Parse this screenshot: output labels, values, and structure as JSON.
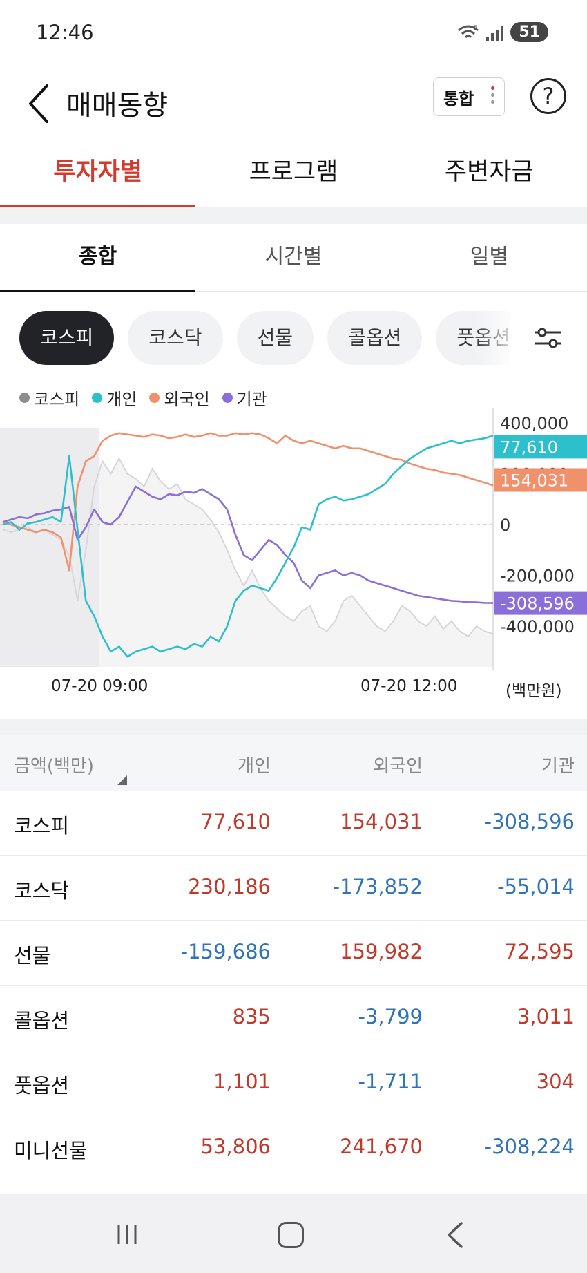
{
  "status": {
    "time": "12:46",
    "wifi_badge": "5",
    "battery": "51"
  },
  "header": {
    "title": "매매동향",
    "combined_label": "통합",
    "help_label": "?"
  },
  "main_tabs": [
    {
      "label": "투자자별",
      "active": true
    },
    {
      "label": "프로그램",
      "active": false
    },
    {
      "label": "주변자금",
      "active": false
    }
  ],
  "sub_tabs": [
    {
      "label": "종합",
      "active": true
    },
    {
      "label": "시간별",
      "active": false
    },
    {
      "label": "일별",
      "active": false
    }
  ],
  "chips": [
    {
      "label": "코스피",
      "active": true
    },
    {
      "label": "코스닥",
      "active": false
    },
    {
      "label": "선물",
      "active": false
    },
    {
      "label": "콜옵션",
      "active": false
    },
    {
      "label": "풋옵션",
      "active": false
    }
  ],
  "chart_data": {
    "type": "line",
    "legend": [
      {
        "label": "코스피",
        "color": "#8e8e92"
      },
      {
        "label": "개인",
        "color": "#2ebfcc"
      },
      {
        "label": "외국인",
        "color": "#f0916c"
      },
      {
        "label": "기관",
        "color": "#8a6fd8"
      }
    ],
    "y_ticks": [
      "400,000",
      "200,000",
      "0",
      "-200,000",
      "-400,000"
    ],
    "y_values": [
      400000,
      200000,
      0,
      -200000,
      -400000
    ],
    "ylim": [
      -560000,
      460000
    ],
    "x_labels": [
      "07-20 09:00",
      "07-20 12:00"
    ],
    "unit": "(백만원)",
    "end_labels": {
      "foreign": {
        "text": "154,031",
        "color": "#f0916c"
      },
      "individual": {
        "text": "77,610",
        "color": "#2ebfcc"
      },
      "institution": {
        "text": "-308,596",
        "color": "#8a6fd8"
      }
    },
    "x_steps": 60,
    "series": {
      "individual": [
        0,
        10000,
        -20000,
        5000,
        10000,
        20000,
        30000,
        10000,
        270000,
        -20000,
        -300000,
        -360000,
        -440000,
        -500000,
        -480000,
        -520000,
        -500000,
        -490000,
        -480000,
        -500000,
        -490000,
        -480000,
        -490000,
        -470000,
        -480000,
        -440000,
        -460000,
        -400000,
        -300000,
        -260000,
        -240000,
        -250000,
        -260000,
        -210000,
        -150000,
        -90000,
        -10000,
        -20000,
        80000,
        100000,
        110000,
        95000,
        100000,
        110000,
        120000,
        140000,
        160000,
        200000,
        230000,
        260000,
        280000,
        300000,
        310000,
        320000,
        330000,
        320000,
        330000,
        335000,
        340000,
        350000
      ],
      "foreign": [
        10000,
        0,
        -10000,
        -20000,
        -30000,
        -20000,
        -30000,
        -50000,
        -180000,
        150000,
        250000,
        270000,
        330000,
        350000,
        360000,
        355000,
        350000,
        345000,
        355000,
        350000,
        340000,
        345000,
        355000,
        345000,
        350000,
        360000,
        350000,
        350000,
        360000,
        355000,
        360000,
        355000,
        340000,
        320000,
        350000,
        330000,
        320000,
        330000,
        320000,
        310000,
        300000,
        310000,
        300000,
        300000,
        290000,
        280000,
        270000,
        260000,
        255000,
        240000,
        230000,
        220000,
        215000,
        205000,
        200000,
        195000,
        185000,
        175000,
        165000,
        154031
      ],
      "institution": [
        10000,
        20000,
        30000,
        25000,
        40000,
        45000,
        55000,
        60000,
        70000,
        -60000,
        -10000,
        60000,
        10000,
        0,
        30000,
        90000,
        150000,
        130000,
        110000,
        100000,
        120000,
        115000,
        130000,
        125000,
        140000,
        120000,
        100000,
        60000,
        -40000,
        -120000,
        -140000,
        -100000,
        -60000,
        -80000,
        -120000,
        -150000,
        -220000,
        -250000,
        -200000,
        -190000,
        -180000,
        -200000,
        -190000,
        -200000,
        -220000,
        -230000,
        -240000,
        -250000,
        -260000,
        -270000,
        -280000,
        -285000,
        -290000,
        -295000,
        -300000,
        -302000,
        -305000,
        -306000,
        -308000,
        -308596
      ],
      "index": [
        -20000,
        -30000,
        -20000,
        -10000,
        -30000,
        -20000,
        -40000,
        -60000,
        -120000,
        -300000,
        -100000,
        150000,
        250000,
        200000,
        260000,
        200000,
        180000,
        150000,
        220000,
        170000,
        140000,
        160000,
        100000,
        80000,
        60000,
        20000,
        -30000,
        -100000,
        -180000,
        -240000,
        -180000,
        -250000,
        -300000,
        -330000,
        -360000,
        -380000,
        -340000,
        -320000,
        -400000,
        -420000,
        -380000,
        -300000,
        -280000,
        -320000,
        -360000,
        -400000,
        -420000,
        -380000,
        -320000,
        -340000,
        -380000,
        -400000,
        -360000,
        -410000,
        -380000,
        -420000,
        -440000,
        -400000,
        -420000,
        -430000
      ]
    }
  },
  "table": {
    "headers": [
      "금액(백만)",
      "개인",
      "외국인",
      "기관"
    ],
    "rows": [
      {
        "name": "코스피",
        "values": [
          "77,610",
          "154,031",
          "-308,596"
        ]
      },
      {
        "name": "코스닥",
        "values": [
          "230,186",
          "-173,852",
          "-55,014"
        ]
      },
      {
        "name": "선물",
        "values": [
          "-159,686",
          "159,982",
          "72,595"
        ]
      },
      {
        "name": "콜옵션",
        "values": [
          "835",
          "-3,799",
          "3,011"
        ]
      },
      {
        "name": "풋옵션",
        "values": [
          "1,101",
          "-1,711",
          "304"
        ]
      },
      {
        "name": "미니선물",
        "values": [
          "53,806",
          "241,670",
          "-308,224"
        ]
      }
    ]
  }
}
